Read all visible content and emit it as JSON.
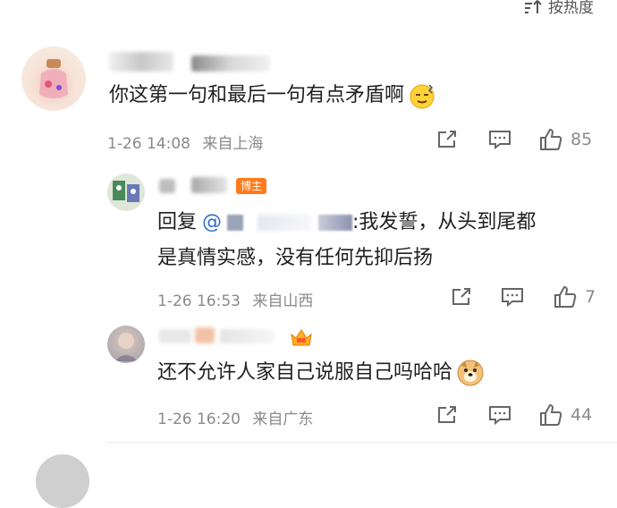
{
  "sort": {
    "label": "按热度"
  },
  "comments": [
    {
      "text": "你这第一句和最后一句有点矛盾啊",
      "time": "1-26 14:08",
      "location": "来自上海",
      "likes": "85"
    }
  ],
  "replies": [
    {
      "badge": "博主",
      "prefix": "回复",
      "at": "@",
      "text_line1": ":我发誓，从头到尾都",
      "text_line2": "是真情实感，没有任何先抑后扬",
      "time": "1-26 16:53",
      "location": "来自山西",
      "likes": "7"
    },
    {
      "text": "还不允许人家自己说服自己吗哈哈",
      "time": "1-26 16:20",
      "location": "来自广东",
      "likes": "44"
    }
  ],
  "colors": {
    "mention": "#2f6ad0",
    "badge": "#ff7a1a",
    "meta": "#8a8a8a"
  },
  "icons": [
    "sort-icon",
    "share-icon",
    "comment-icon",
    "like-icon",
    "sweat-emoji-icon",
    "doge-emoji-icon",
    "crown-icon"
  ]
}
